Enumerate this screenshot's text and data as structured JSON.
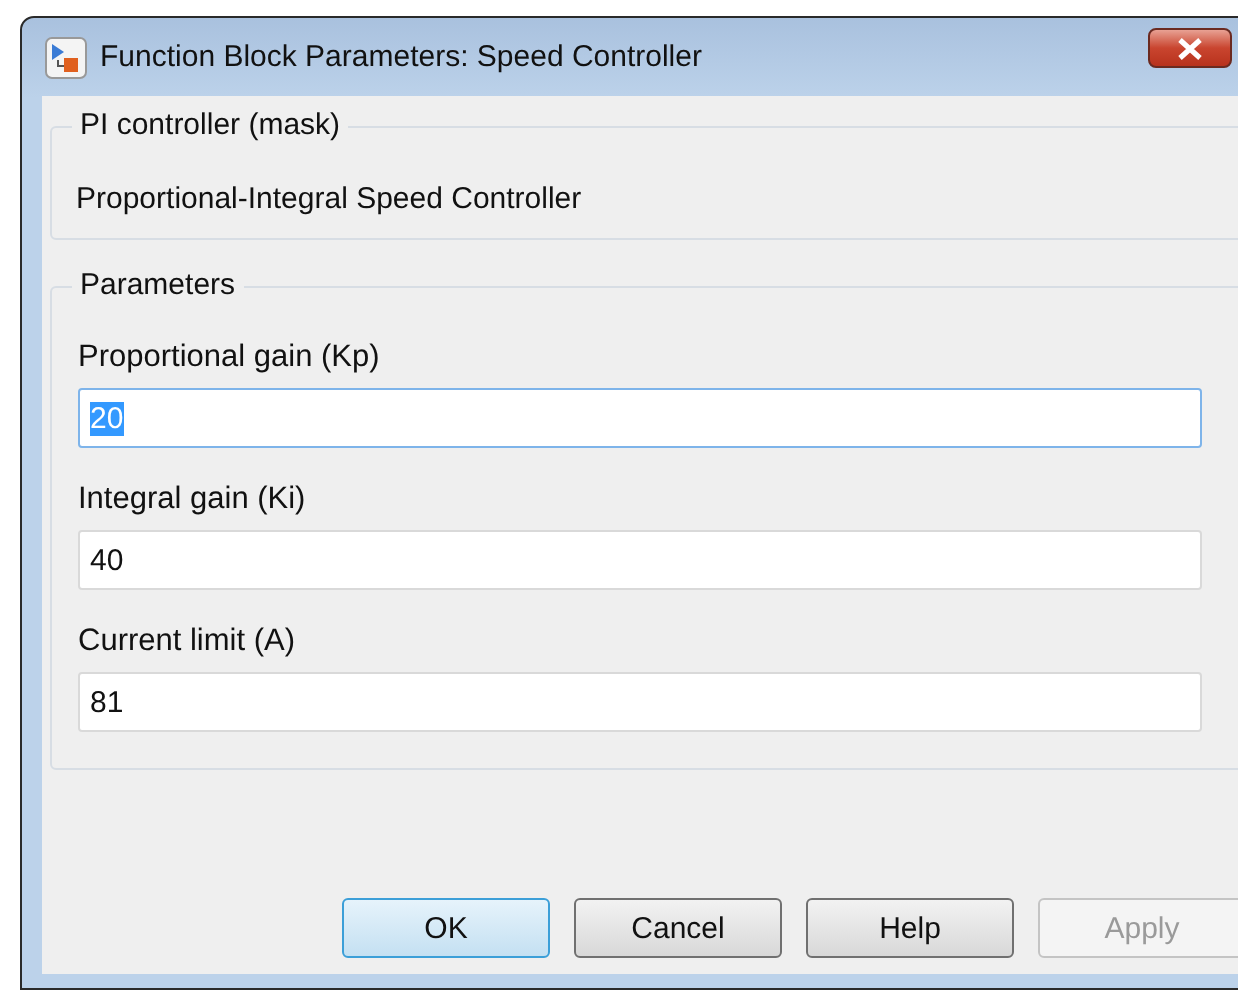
{
  "window": {
    "title": "Function Block Parameters: Speed Controller"
  },
  "description_group": {
    "title": "PI controller (mask)",
    "text": "Proportional-Integral Speed Controller"
  },
  "parameters_group": {
    "title": "Parameters",
    "fields": [
      {
        "label": "Proportional gain (Kp)",
        "value": "20",
        "selected": true
      },
      {
        "label": "Integral gain (Ki)",
        "value": "40",
        "selected": false
      },
      {
        "label": "Current limit (A)",
        "value": "81",
        "selected": false
      }
    ]
  },
  "buttons": [
    {
      "label": "OK",
      "default": true,
      "disabled": false
    },
    {
      "label": "Cancel",
      "default": false,
      "disabled": false
    },
    {
      "label": "Help",
      "default": false,
      "disabled": false
    },
    {
      "label": "Apply",
      "default": false,
      "disabled": true
    }
  ]
}
